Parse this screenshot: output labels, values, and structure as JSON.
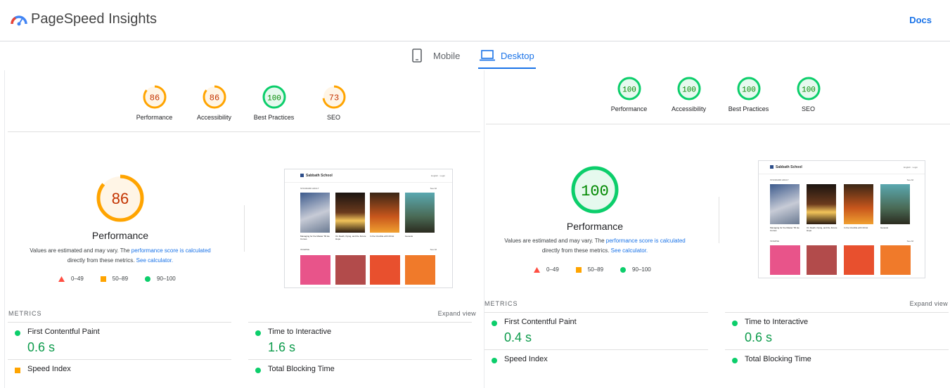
{
  "header": {
    "brand": "PageSpeed Insights",
    "docs": "Docs"
  },
  "tabs": {
    "mobile": "Mobile",
    "desktop": "Desktop"
  },
  "left": {
    "scores": [
      {
        "label": "Performance",
        "value": "86",
        "status": "average"
      },
      {
        "label": "Accessibility",
        "value": "86",
        "status": "average"
      },
      {
        "label": "Best Practices",
        "value": "100",
        "status": "pass"
      },
      {
        "label": "SEO",
        "value": "73",
        "status": "average"
      }
    ],
    "big": {
      "value": "86",
      "title": "Performance",
      "score_fraction": 0.86
    },
    "metrics": [
      {
        "name": "First Contentful Paint",
        "value": "0.6 s"
      },
      {
        "name": "Time to Interactive",
        "value": "1.6 s"
      },
      {
        "name": "Speed Index",
        "value": ""
      },
      {
        "name": "Total Blocking Time",
        "value": ""
      }
    ]
  },
  "right": {
    "scores": [
      {
        "label": "Performance",
        "value": "100",
        "status": "pass"
      },
      {
        "label": "Accessibility",
        "value": "100",
        "status": "pass"
      },
      {
        "label": "Best Practices",
        "value": "100",
        "status": "pass"
      },
      {
        "label": "SEO",
        "value": "100",
        "status": "pass"
      }
    ],
    "big": {
      "value": "100",
      "title": "Performance",
      "score_fraction": 1.0
    },
    "metrics": [
      {
        "name": "First Contentful Paint",
        "value": "0.4 s"
      },
      {
        "name": "Time to Interactive",
        "value": "0.6 s"
      },
      {
        "name": "Speed Index",
        "value": ""
      },
      {
        "name": "Total Blocking Time",
        "value": ""
      }
    ]
  },
  "note": {
    "pre": "Values are estimated and may vary. The ",
    "link1": "performance score is calculated",
    "mid": "directly from these metrics. ",
    "link2": "See calculator."
  },
  "legend": {
    "fail": "0–49",
    "average": "50–89",
    "pass": "90–100"
  },
  "metrics_header": "METRICS",
  "expand": "Expand view",
  "screenshot": {
    "brand": "Sabbath School",
    "section1": "STANDARD ADULT",
    "section2": "INVERSE",
    "see_all": "See All",
    "menu": "English  ·  Login",
    "books": [
      "Managing for the Master Till He Comes",
      "On Death, Dying, and the Future Hope",
      "In the Crucible with Christ",
      "Genesis"
    ]
  },
  "colors": {
    "pass": "#0cce6b",
    "pass_text": "#008800",
    "average": "#ffa400",
    "average_text": "#c33300",
    "fail": "#ff4e42",
    "link": "#1a73e8"
  }
}
